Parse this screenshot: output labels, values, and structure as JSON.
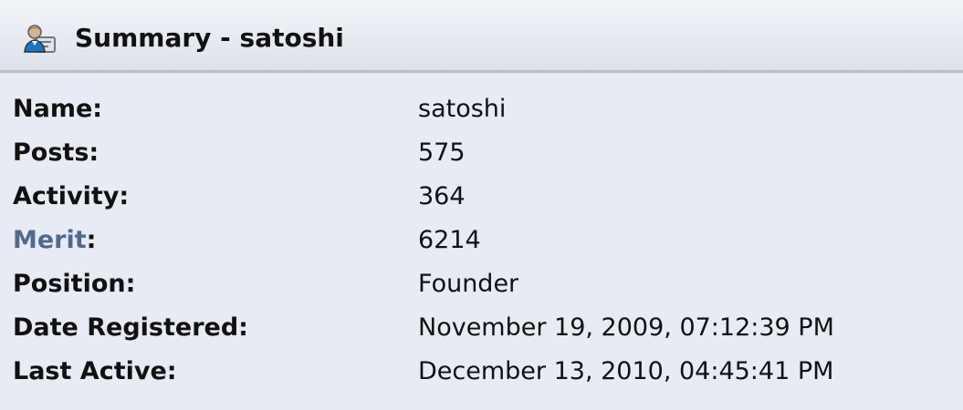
{
  "header": {
    "title": "Summary - satoshi",
    "icon": "user-profile-icon"
  },
  "summary": {
    "rows": [
      {
        "label": "Name:",
        "value": "satoshi"
      },
      {
        "label": "Posts:",
        "value": "575"
      },
      {
        "label": "Activity:",
        "value": "364"
      },
      {
        "label_link": "Merit",
        "label_suffix": ":",
        "value": "6214"
      },
      {
        "label": "Position:",
        "value": "Founder"
      },
      {
        "label": "Date Registered:",
        "value": "November 19, 2009, 07:12:39 PM"
      },
      {
        "label": "Last Active:",
        "value": "December 13, 2010, 04:45:41 PM"
      }
    ]
  },
  "colors": {
    "link": "#4f6a8d",
    "background": "#e8ebf3",
    "header_border": "#b7bfcc"
  }
}
